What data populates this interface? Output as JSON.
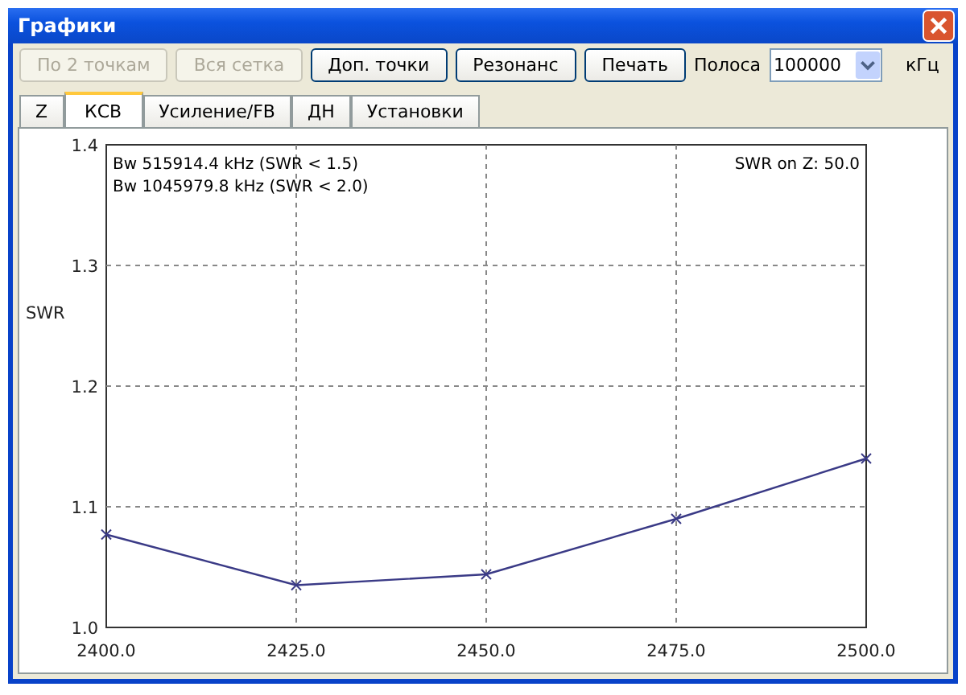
{
  "window": {
    "title": "Графики"
  },
  "toolbar": {
    "buttons": [
      {
        "label": "По 2 точкам",
        "disabled": true
      },
      {
        "label": "Вся сетка",
        "disabled": true
      },
      {
        "label": "Доп. точки",
        "disabled": false
      },
      {
        "label": "Резонанс",
        "disabled": false
      },
      {
        "label": "Печать",
        "disabled": false
      }
    ],
    "band": {
      "label": "Полоса",
      "value": "100000",
      "unit": "кГц"
    }
  },
  "tabs": [
    {
      "label": "Z",
      "selected": false
    },
    {
      "label": "КСВ",
      "selected": true
    },
    {
      "label": "Усиление/FB",
      "selected": false
    },
    {
      "label": "ДН",
      "selected": false
    },
    {
      "label": "Установки",
      "selected": false
    }
  ],
  "chart": {
    "chart_data": {
      "type": "line",
      "ylabel": "SWR",
      "x": [
        2400,
        2425,
        2450,
        2475,
        2500
      ],
      "grid": true,
      "series": [
        {
          "color": "#3a3a86",
          "marker": "x",
          "values": [
            1.077,
            1.035,
            1.044,
            1.09,
            1.14
          ]
        }
      ],
      "xlim": [
        2400,
        2500
      ],
      "ylim": [
        1.0,
        1.4
      ],
      "xticks": [
        {
          "value": 2400,
          "label": "2400.0"
        },
        {
          "value": 2425,
          "label": "2425.0"
        },
        {
          "value": 2450,
          "label": "2450.0"
        },
        {
          "value": 2475,
          "label": "2475.0"
        },
        {
          "value": 2500,
          "label": "2500.0"
        }
      ],
      "yticks": [
        {
          "value": 1.0,
          "label": "1.0"
        },
        {
          "value": 1.1,
          "label": "1.1"
        },
        {
          "value": 1.2,
          "label": "1.2"
        },
        {
          "value": 1.3,
          "label": "1.3"
        },
        {
          "value": 1.4,
          "label": "1.4"
        }
      ],
      "annotations": [
        "Bw 515914.4 kHz (SWR < 1.5)",
        "Bw 1045979.8 kHz (SWR < 2.0)"
      ]
    },
    "impedance_note": "SWR on Z: 50.0"
  }
}
